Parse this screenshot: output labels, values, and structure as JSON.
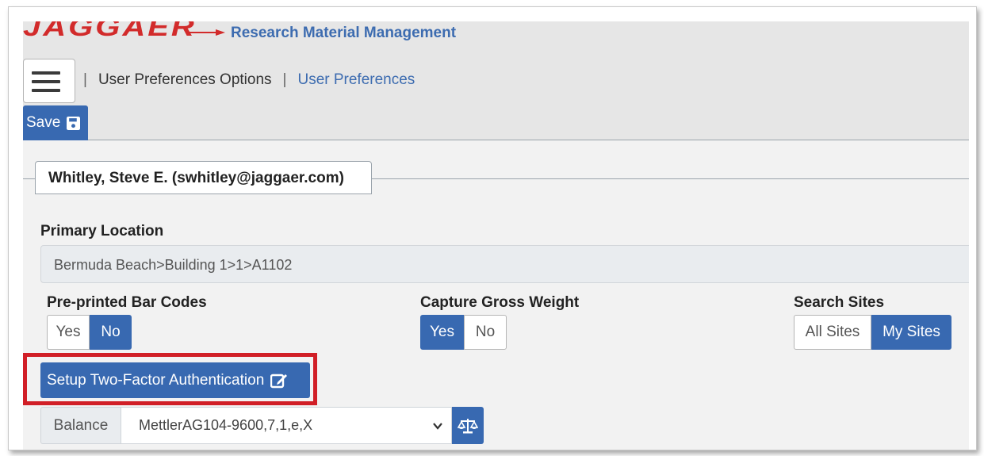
{
  "brand": {
    "logo_text": "JAGGAER",
    "app_title": "Research Material Management"
  },
  "breadcrumb": {
    "separator": "|",
    "section": "User Preferences Options",
    "current": "User Preferences"
  },
  "toolbar": {
    "save_label": "Save",
    "save_icon": "floppy-disk-icon"
  },
  "user": {
    "tab_label": "Whitley, Steve E. (swhitley@jaggaer.com)"
  },
  "primary_location": {
    "label": "Primary Location",
    "value": "Bermuda Beach>Building 1>1>A1102"
  },
  "barcodes": {
    "label": "Pre-printed Bar Codes",
    "options": [
      "Yes",
      "No"
    ],
    "selected": "No"
  },
  "gross_weight": {
    "label": "Capture Gross Weight",
    "options": [
      "Yes",
      "No"
    ],
    "selected": "Yes"
  },
  "search_sites": {
    "label": "Search Sites",
    "options": [
      "All Sites",
      "My Sites"
    ],
    "selected": "My Sites"
  },
  "two_factor": {
    "button_label": "Setup Two-Factor Authentication",
    "icon": "edit-icon"
  },
  "balance": {
    "label": "Balance",
    "selected_value": "MettlerAG104-9600,7,1,e,X",
    "button_icon": "scale-icon"
  },
  "colors": {
    "primary": "#3869b1",
    "brand_red": "#d22b2b",
    "highlight": "#d11f27"
  }
}
